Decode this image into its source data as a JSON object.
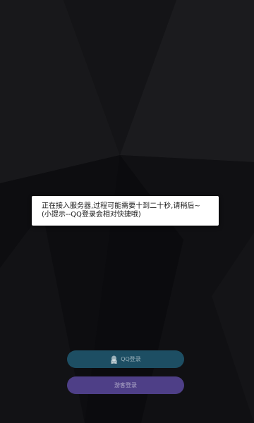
{
  "dialog": {
    "line1": "正在接入服务器,过程可能需要十到二十秒,请稍后~",
    "line2": "(小提示--QQ登录会相对快捷哦)"
  },
  "buttons": {
    "qq_login_label": "QQ登录",
    "guest_login_label": "游客登录"
  },
  "colors": {
    "background": "#0f0f11",
    "qq_button": "#1d4e63",
    "guest_button": "#4e3f87",
    "dialog_bg": "#ffffff"
  },
  "icons": {
    "qq_button_icon": "qq-penguin-icon"
  }
}
